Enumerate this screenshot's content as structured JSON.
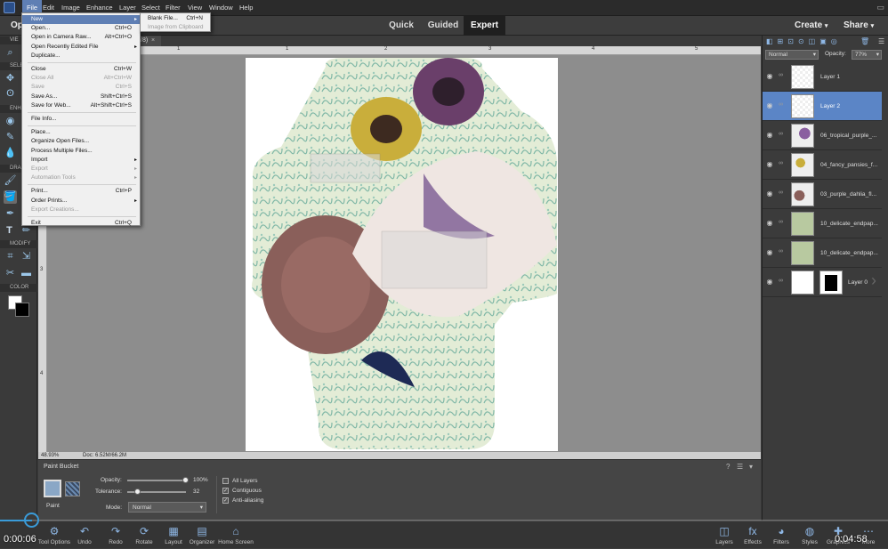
{
  "menubar": {
    "items": [
      "File",
      "Edit",
      "Image",
      "Enhance",
      "Layer",
      "Select",
      "Filter",
      "View",
      "Window",
      "Help"
    ]
  },
  "modebar": {
    "open_label": "Op",
    "modes": [
      "Quick",
      "Guided",
      "Expert"
    ],
    "create_label": "Create",
    "share_label": "Share"
  },
  "tab": {
    "partial_text": "/8)",
    "close": "×"
  },
  "toolbox": {
    "sections": [
      "VIE",
      "SELE",
      "ENHA",
      "DRA",
      "MODIFY",
      "COLOR"
    ]
  },
  "rulers": {
    "top_ticks": [
      "1",
      "1",
      "2",
      "3",
      "4",
      "5",
      "6",
      "7",
      "8"
    ],
    "left_ticks": [
      "1",
      "2",
      "3",
      "4",
      "5"
    ]
  },
  "statusbar": {
    "zoom": "48.93%",
    "doc": "Doc: 6.52M/66.2M"
  },
  "tool_options": {
    "tool_name": "Paint Bucket",
    "paint_label": "Paint",
    "opacity_label": "Opacity:",
    "opacity_value": "100%",
    "opacity_fraction": 1.0,
    "tolerance_label": "Tolerance:",
    "tolerance_value": "32",
    "tolerance_fraction": 0.13,
    "mode_label": "Mode:",
    "mode_value": "Normal",
    "all_layers": "All Layers",
    "contiguous": "Contiguous",
    "anti_aliasing": "Anti-aliasing"
  },
  "layers_panel": {
    "blend_mode": "Normal",
    "opacity_label": "Opacity:",
    "opacity_value": "77%",
    "layers": [
      {
        "name": "Layer 1",
        "selected": false
      },
      {
        "name": "Layer 2",
        "selected": true
      },
      {
        "name": "06_tropical_purple_...",
        "selected": false
      },
      {
        "name": "04_fancy_pansies_f...",
        "selected": false
      },
      {
        "name": "03_purple_dahlia_fl...",
        "selected": false
      },
      {
        "name": "10_delicate_endpap...",
        "selected": false
      },
      {
        "name": "10_delicate_endpap...",
        "selected": false
      },
      {
        "name": "Layer 0",
        "selected": false
      }
    ]
  },
  "bottombar": {
    "left": [
      "Tool Options",
      "Undo",
      "Redo",
      "Rotate",
      "Layout",
      "Organizer",
      "Home Screen"
    ],
    "right": [
      "Layers",
      "Effects",
      "Filters",
      "Styles",
      "Graphics",
      "More"
    ]
  },
  "file_menu": {
    "items": [
      {
        "label": "New",
        "shortcut": "",
        "submenu": true,
        "disabled": false,
        "highlight": true
      },
      {
        "label": "Open...",
        "shortcut": "Ctrl+O",
        "disabled": false
      },
      {
        "label": "Open in Camera Raw...",
        "shortcut": "Alt+Ctrl+O",
        "disabled": false
      },
      {
        "label": "Open Recently Edited File",
        "shortcut": "",
        "submenu": true,
        "disabled": false
      },
      {
        "label": "Duplicate...",
        "shortcut": "",
        "disabled": false
      },
      {
        "sep": true
      },
      {
        "label": "Close",
        "shortcut": "Ctrl+W",
        "disabled": false
      },
      {
        "label": "Close All",
        "shortcut": "Alt+Ctrl+W",
        "disabled": true
      },
      {
        "label": "Save",
        "shortcut": "Ctrl+S",
        "disabled": true
      },
      {
        "label": "Save As...",
        "shortcut": "Shift+Ctrl+S",
        "disabled": false
      },
      {
        "label": "Save for Web...",
        "shortcut": "Alt+Shift+Ctrl+S",
        "disabled": false
      },
      {
        "sep": true
      },
      {
        "label": "File Info...",
        "shortcut": "",
        "disabled": false
      },
      {
        "sep": true
      },
      {
        "label": "Place...",
        "shortcut": "",
        "disabled": false
      },
      {
        "label": "Organize Open Files...",
        "shortcut": "",
        "disabled": false
      },
      {
        "label": "Process Multiple Files...",
        "shortcut": "",
        "disabled": false
      },
      {
        "label": "Import",
        "shortcut": "",
        "submenu": true,
        "disabled": false
      },
      {
        "label": "Export",
        "shortcut": "",
        "submenu": true,
        "disabled": true
      },
      {
        "label": "Automation Tools",
        "shortcut": "",
        "submenu": true,
        "disabled": true
      },
      {
        "sep": true
      },
      {
        "label": "Print...",
        "shortcut": "Ctrl+P",
        "disabled": false
      },
      {
        "label": "Order Prints...",
        "shortcut": "",
        "submenu": true,
        "disabled": false
      },
      {
        "label": "Export Creations...",
        "shortcut": "",
        "disabled": true
      },
      {
        "sep": true
      },
      {
        "label": "Exit",
        "shortcut": "Ctrl+Q",
        "disabled": false
      }
    ]
  },
  "new_submenu": {
    "items": [
      {
        "label": "Blank File...",
        "shortcut": "Ctrl+N",
        "disabled": false
      },
      {
        "label": "Image from Clipboard",
        "shortcut": "",
        "disabled": true
      }
    ]
  },
  "video": {
    "elapsed": "0:00:06",
    "remaining": "0:04:58"
  },
  "colors": {
    "accent": "#5f7fb4",
    "layer_selected": "#5b85c6",
    "menubar": "#2b2b2b",
    "panel": "#3b3b3b",
    "canvas_bg": "#8d8d8d"
  }
}
